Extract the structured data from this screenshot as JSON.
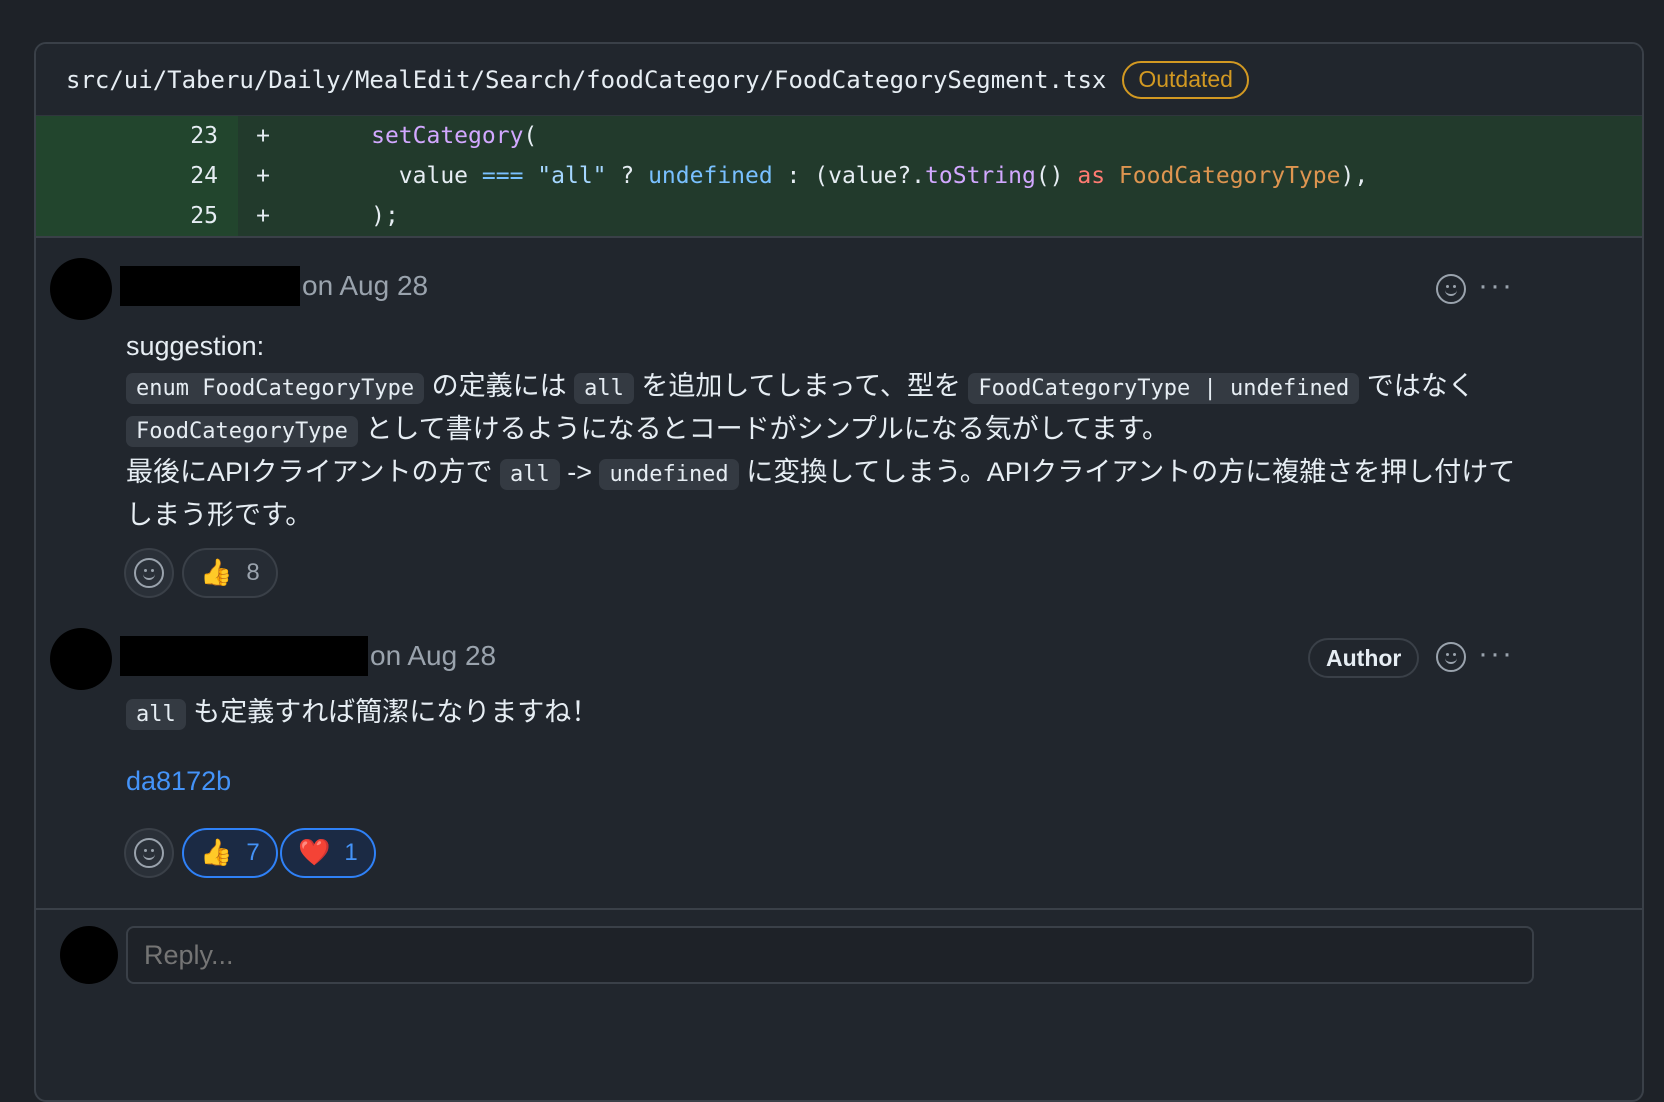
{
  "file": {
    "path": "src/ui/Taberu/Daily/MealEdit/Search/foodCategory/FoodCategorySegment.tsx",
    "badge": "Outdated"
  },
  "diff": {
    "lines": [
      {
        "num": "23",
        "sign": "+"
      },
      {
        "num": "24",
        "sign": "+"
      },
      {
        "num": "25",
        "sign": "+"
      }
    ],
    "code_tokens": {
      "l23_indent": "      ",
      "l23_fn": "setCategory",
      "l23_paren": "(",
      "l24_indent": "        ",
      "l24_value": "value ",
      "l24_eq": "===",
      "l24_space": " ",
      "l24_str": "\"all\"",
      "l24_q": " ? ",
      "l24_undef": "undefined",
      "l24_colon": " : (value?.",
      "l24_tostring": "toString",
      "l24_call": "() ",
      "l24_as": "as",
      "l24_sp2": " ",
      "l24_type": "FoodCategoryType",
      "l24_end": "),",
      "l25_indent": "      ",
      "l25_close": ");"
    }
  },
  "comments": [
    {
      "date": "on Aug 28",
      "body": {
        "line1": "suggestion:",
        "code_enum": "enum FoodCategoryType",
        "t_a": " の定義には ",
        "code_all_1": "all",
        "t_b": " を追加してしまって、型を ",
        "code_union": "FoodCategoryType | undefined",
        "t_c": " ではなく",
        "code_type": "FoodCategoryType",
        "t_d": " として書けるようになるとコードがシンプルになる気がしてます。",
        "t_e": "最後にAPIクライアントの方で ",
        "code_all_2": "all",
        "t_f": " -> ",
        "code_undefined": "undefined",
        "t_g": " に変換してしまう。APIクライアントの方に複雑さを押し付けて",
        "t_h": "しまう形です。"
      },
      "reactions": [
        {
          "emoji": "👍",
          "count": "8"
        }
      ]
    },
    {
      "date": "on Aug 28",
      "badge": "Author",
      "body": {
        "code_all": "all",
        "text": " も定義すれば簡潔になりますね！",
        "link": "da8172b"
      },
      "reactions": [
        {
          "emoji": "👍",
          "count": "7"
        },
        {
          "emoji": "❤️",
          "count": "1"
        }
      ]
    }
  ],
  "reply": {
    "placeholder": "Reply..."
  },
  "icons": {
    "smile": "smiley-add-reaction-icon",
    "more": "kebab-horizontal-icon",
    "more_glyph": "···"
  },
  "colors": {
    "accent_blue": "#4493f8",
    "outdated": "#d29922",
    "diff_add_bg": "#223a2c"
  }
}
